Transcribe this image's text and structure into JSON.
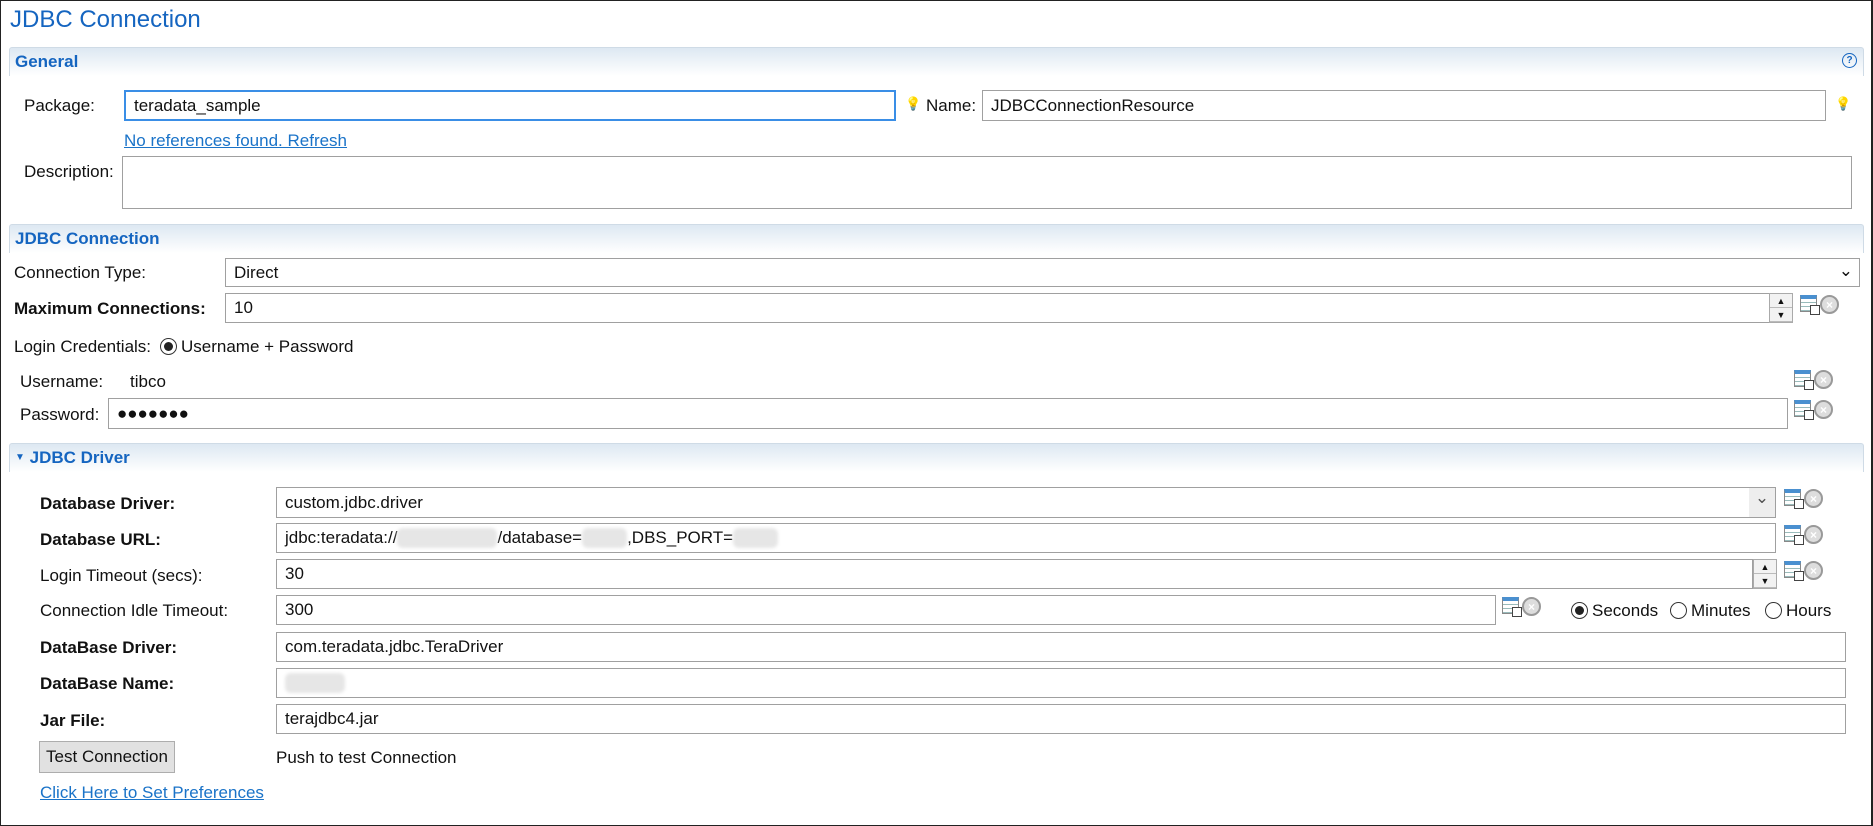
{
  "title": "JDBC Connection",
  "general": {
    "header": "General",
    "help_icon": "help-icon",
    "package_label": "Package:",
    "package_value": "teradata_sample",
    "name_label": "Name:",
    "name_value": "JDBCConnectionResource",
    "references_link": "No references found. Refresh",
    "description_label": "Description:",
    "description_value": ""
  },
  "connection": {
    "header": "JDBC Connection",
    "type_label": "Connection Type:",
    "type_value": "Direct",
    "max_label": "Maximum Connections:",
    "max_value": "10",
    "login_label": "Login Credentials:",
    "login_option": "Username + Password",
    "username_label": "Username:",
    "username_value": "tibco",
    "password_label": "Password:",
    "password_value": "●●●●●●●"
  },
  "driver": {
    "header": "JDBC Driver",
    "db_driver_label": "Database Driver:",
    "db_driver_value": "custom.jdbc.driver",
    "url_label": "Database URL:",
    "url_prefix": "jdbc:teradata://",
    "url_mid": "/database=",
    "url_mid2": ",DBS_PORT=",
    "login_timeout_label": "Login Timeout (secs):",
    "login_timeout_value": "30",
    "idle_label": "Connection Idle Timeout:",
    "idle_value": "300",
    "units": [
      "Seconds",
      "Minutes",
      "Hours"
    ],
    "selected_unit": "Seconds",
    "database_driver_label": "DataBase Driver:",
    "database_driver_value": "com.teradata.jdbc.TeraDriver",
    "database_name_label": "DataBase Name:",
    "jar_label": "Jar File:",
    "jar_value": "terajdbc4.jar",
    "test_button": "Test Connection",
    "test_hint": "Push to test Connection",
    "prefs_link": "Click Here to Set Preferences"
  }
}
